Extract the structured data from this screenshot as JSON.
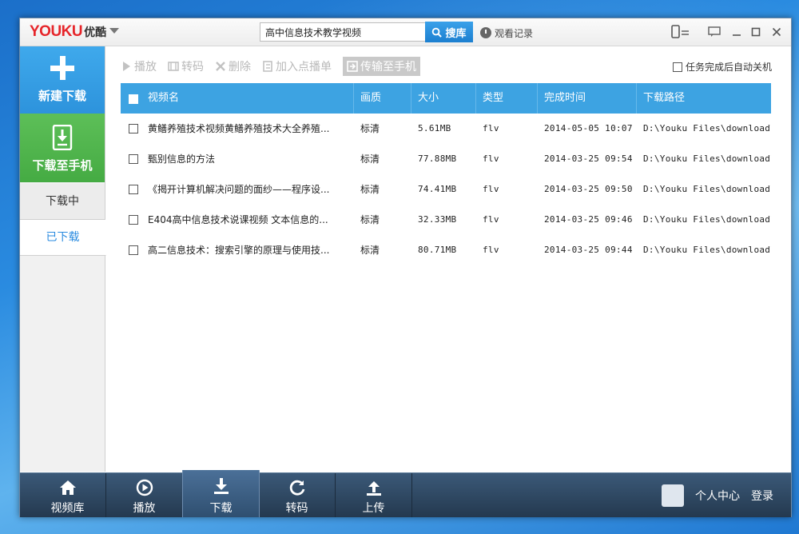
{
  "app": {
    "logo_en": "YOUKU",
    "logo_cn": "优酷"
  },
  "search": {
    "value": "高中信息技术教学视频",
    "button_label": "搜库"
  },
  "history": {
    "label": "观看记录"
  },
  "sidebar": {
    "new_download": "新建下载",
    "download_to_phone": "下载至手机",
    "tabs": [
      {
        "label": "下载中",
        "selected": false
      },
      {
        "label": "已下载",
        "selected": true
      }
    ]
  },
  "toolbar": {
    "play": "播放",
    "transcode": "转码",
    "delete": "删除",
    "add_to_playlist": "加入点播单",
    "transfer_to_phone": "传输至手机",
    "auto_shutdown": "任务完成后自动关机"
  },
  "table": {
    "headers": [
      "视频名",
      "画质",
      "大小",
      "类型",
      "完成时间",
      "下载路径"
    ],
    "rows": [
      {
        "name": "黄鳝养殖技术视频黄鳝养殖技术大全养殖...",
        "quality": "标清",
        "size": "5.61MB",
        "type": "flv",
        "time": "2014-05-05 10:07",
        "path": "D:\\Youku Files\\download\\"
      },
      {
        "name": "甄别信息的方法",
        "quality": "标清",
        "size": "77.88MB",
        "type": "flv",
        "time": "2014-03-25 09:54",
        "path": "D:\\Youku Files\\download\\"
      },
      {
        "name": "《揭开计算机解决问题的面纱——程序设...",
        "quality": "标清",
        "size": "74.41MB",
        "type": "flv",
        "time": "2014-03-25 09:50",
        "path": "D:\\Youku Files\\download\\"
      },
      {
        "name": "E404高中信息技术说课视频 文本信息的...",
        "quality": "标清",
        "size": "32.33MB",
        "type": "flv",
        "time": "2014-03-25 09:46",
        "path": "D:\\Youku Files\\download\\"
      },
      {
        "name": "高二信息技术：搜索引擎的原理与使用技...",
        "quality": "标清",
        "size": "80.71MB",
        "type": "flv",
        "time": "2014-03-25 09:44",
        "path": "D:\\Youku Files\\download\\"
      }
    ]
  },
  "bottom_nav": [
    {
      "label": "视频库",
      "icon": "home-icon"
    },
    {
      "label": "播放",
      "icon": "play-icon"
    },
    {
      "label": "下载",
      "icon": "download-icon",
      "active": true
    },
    {
      "label": "转码",
      "icon": "refresh-icon"
    },
    {
      "label": "上传",
      "icon": "upload-icon"
    }
  ],
  "user": {
    "center": "个人中心",
    "login": "登录"
  },
  "colors": {
    "accent_blue": "#3da3e2",
    "new_download_bg": "#3fa9ec",
    "phone_green": "#45ab43",
    "nav_bg": "#2b4560"
  }
}
